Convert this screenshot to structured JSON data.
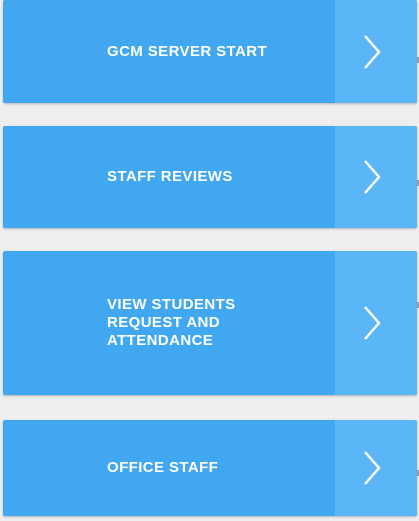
{
  "menu": {
    "items": [
      {
        "label": "GCM SERVER START",
        "icon": "chevron-right-icon"
      },
      {
        "label": "STAFF REVIEWS",
        "icon": "chevron-right-icon"
      },
      {
        "label": "VIEW STUDENTS\nREQUEST AND\nATTENDANCE",
        "icon": "chevron-right-icon"
      },
      {
        "label": "OFFICE STAFF",
        "icon": "chevron-right-icon"
      }
    ]
  },
  "colors": {
    "background": "#eeeeee",
    "card": "#42a7f1",
    "chevron_panel": "#5ab6f7",
    "text": "#ffffff"
  }
}
